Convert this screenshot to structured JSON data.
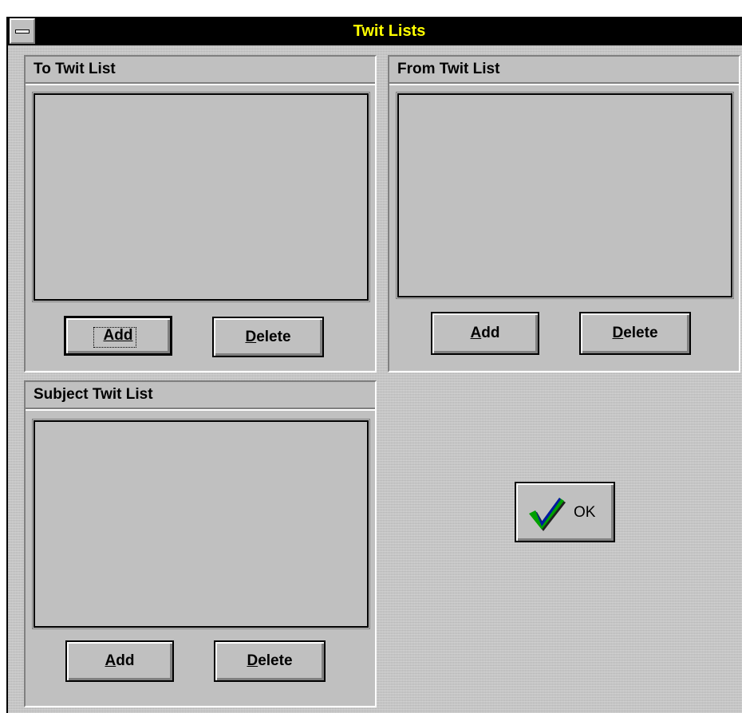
{
  "window": {
    "title": "Twit Lists"
  },
  "groups": {
    "to": {
      "title": "To Twit List",
      "add_label": "Add",
      "delete_label": "Delete"
    },
    "from": {
      "title": "From Twit List",
      "add_label": "Add",
      "delete_label": "Delete"
    },
    "subject": {
      "title": "Subject Twit List",
      "add_label": "Add",
      "delete_label": "Delete"
    }
  },
  "ok_button": {
    "label": "OK",
    "icon": "checkmark-icon"
  },
  "colors": {
    "title_bar_bg": "#000000",
    "title_text": "#ffff00",
    "dialog_face": "#c0c0c0",
    "check_green": "#00a000",
    "check_blue": "#0000c0"
  }
}
